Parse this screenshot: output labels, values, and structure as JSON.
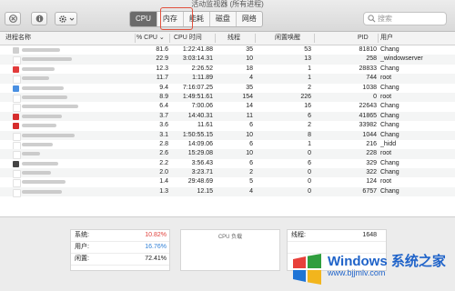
{
  "window": {
    "title": "活动监视器 (所有进程)"
  },
  "toolbar": {
    "tabs": [
      "CPU",
      "内存",
      "能耗",
      "磁盘",
      "网络"
    ],
    "active_tab": "CPU",
    "highlighted_tab": "内存",
    "search_placeholder": "搜索"
  },
  "table": {
    "headers": {
      "name": "进程名称",
      "cpu": "% CPU",
      "time": "CPU 时间",
      "threads": "线程",
      "idle_wake": "闲置唤醒",
      "pid": "PID",
      "user": "用户"
    },
    "sort_indicator": "⌄",
    "rows": [
      {
        "cpu": "81.6",
        "time": "1:22:41.88",
        "threads": "35",
        "idle": "53",
        "pid": "81810",
        "user": "Chang",
        "icon": "#cfcfcf",
        "blur": 42
      },
      {
        "cpu": "22.9",
        "time": "3:03:14.31",
        "threads": "10",
        "idle": "13",
        "pid": "258",
        "user": "_windowserver",
        "icon": "#ffffff",
        "blur": 55
      },
      {
        "cpu": "12.3",
        "time": "2:26.52",
        "threads": "18",
        "idle": "1",
        "pid": "28833",
        "user": "Chang",
        "icon": "#e23b3b",
        "blur": 36
      },
      {
        "cpu": "11.7",
        "time": "1:11.89",
        "threads": "4",
        "idle": "1",
        "pid": "744",
        "user": "root",
        "icon": "#ffffff",
        "blur": 30
      },
      {
        "cpu": "9.4",
        "time": "7:16:07.25",
        "threads": "35",
        "idle": "2",
        "pid": "1038",
        "user": "Chang",
        "icon": "#4a90e2",
        "blur": 46
      },
      {
        "cpu": "8.9",
        "time": "1:49:51.61",
        "threads": "154",
        "idle": "226",
        "pid": "0",
        "user": "root",
        "icon": "#ffffff",
        "blur": 50
      },
      {
        "cpu": "6.4",
        "time": "7:00.06",
        "threads": "14",
        "idle": "16",
        "pid": "22643",
        "user": "Chang",
        "icon": "#ffffff",
        "blur": 62
      },
      {
        "cpu": "3.7",
        "time": "14:40.31",
        "threads": "11",
        "idle": "6",
        "pid": "41865",
        "user": "Chang",
        "icon": "#d62d2d",
        "blur": 44
      },
      {
        "cpu": "3.6",
        "time": "11.61",
        "threads": "6",
        "idle": "2",
        "pid": "33982",
        "user": "Chang",
        "icon": "#d62d2d",
        "blur": 38
      },
      {
        "cpu": "3.1",
        "time": "1:50:55.15",
        "threads": "10",
        "idle": "8",
        "pid": "1044",
        "user": "Chang",
        "icon": "#ffffff",
        "blur": 58
      },
      {
        "cpu": "2.8",
        "time": "14:09.06",
        "threads": "6",
        "idle": "1",
        "pid": "216",
        "user": "_hidd",
        "icon": "#ffffff",
        "blur": 34
      },
      {
        "cpu": "2.6",
        "time": "15:29.08",
        "threads": "10",
        "idle": "0",
        "pid": "228",
        "user": "root",
        "icon": "#ffffff",
        "blur": 20
      },
      {
        "cpu": "2.2",
        "time": "3:56.43",
        "threads": "6",
        "idle": "6",
        "pid": "329",
        "user": "Chang",
        "icon": "#444444",
        "blur": 40
      },
      {
        "cpu": "2.0",
        "time": "3:23.71",
        "threads": "2",
        "idle": "0",
        "pid": "322",
        "user": "Chang",
        "icon": "#ffffff",
        "blur": 32
      },
      {
        "cpu": "1.4",
        "time": "29:48.69",
        "threads": "5",
        "idle": "0",
        "pid": "124",
        "user": "root",
        "icon": "#ffffff",
        "blur": 48
      },
      {
        "cpu": "1.3",
        "time": "12.15",
        "threads": "4",
        "idle": "0",
        "pid": "6757",
        "user": "Chang",
        "icon": "#ffffff",
        "blur": 44
      }
    ]
  },
  "footer": {
    "stats": [
      {
        "label": "系统:",
        "value": "10.82%",
        "color": "#e0413b"
      },
      {
        "label": "用户:",
        "value": "16.76%",
        "color": "#2f7fd6"
      },
      {
        "label": "闲置:",
        "value": "72.41%",
        "color": "#333333"
      }
    ],
    "cpu_load_title": "CPU 负载",
    "threads_label": "线程:",
    "threads_value": "1648"
  },
  "watermark": {
    "brand": "Windows 系统之家",
    "url": "www.bjjmlv.com"
  },
  "colors": {
    "accent_highlight": "#e2503c",
    "system": "#e0413b",
    "user": "#2f7fd6"
  }
}
